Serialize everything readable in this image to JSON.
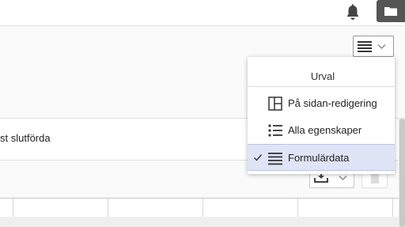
{
  "topbar": {
    "icons": [
      "bell-icon",
      "folder-icon"
    ]
  },
  "toolbar": {
    "view_toggle_icons": [
      "list-lines-icon",
      "chevron-down-icon"
    ]
  },
  "status": {
    "text": "st slutförda"
  },
  "actions": {
    "icons": [
      "download-icon",
      "chevron-down-icon",
      "trash-icon"
    ]
  },
  "menu": {
    "header": "Urval",
    "items": [
      {
        "label": "På sidan-redigering",
        "icon": "split-panel-icon",
        "selected": false
      },
      {
        "label": "Alla egenskaper",
        "icon": "bullet-list-icon",
        "selected": false
      },
      {
        "label": "Formulärdata",
        "icon": "list-lines-icon",
        "selected": true
      }
    ],
    "selected_mark": "check-icon",
    "selected_color": "#dfe4f7"
  },
  "colors": {
    "topbar_button": "#555555",
    "menu_selected": "#dfe4f7"
  }
}
